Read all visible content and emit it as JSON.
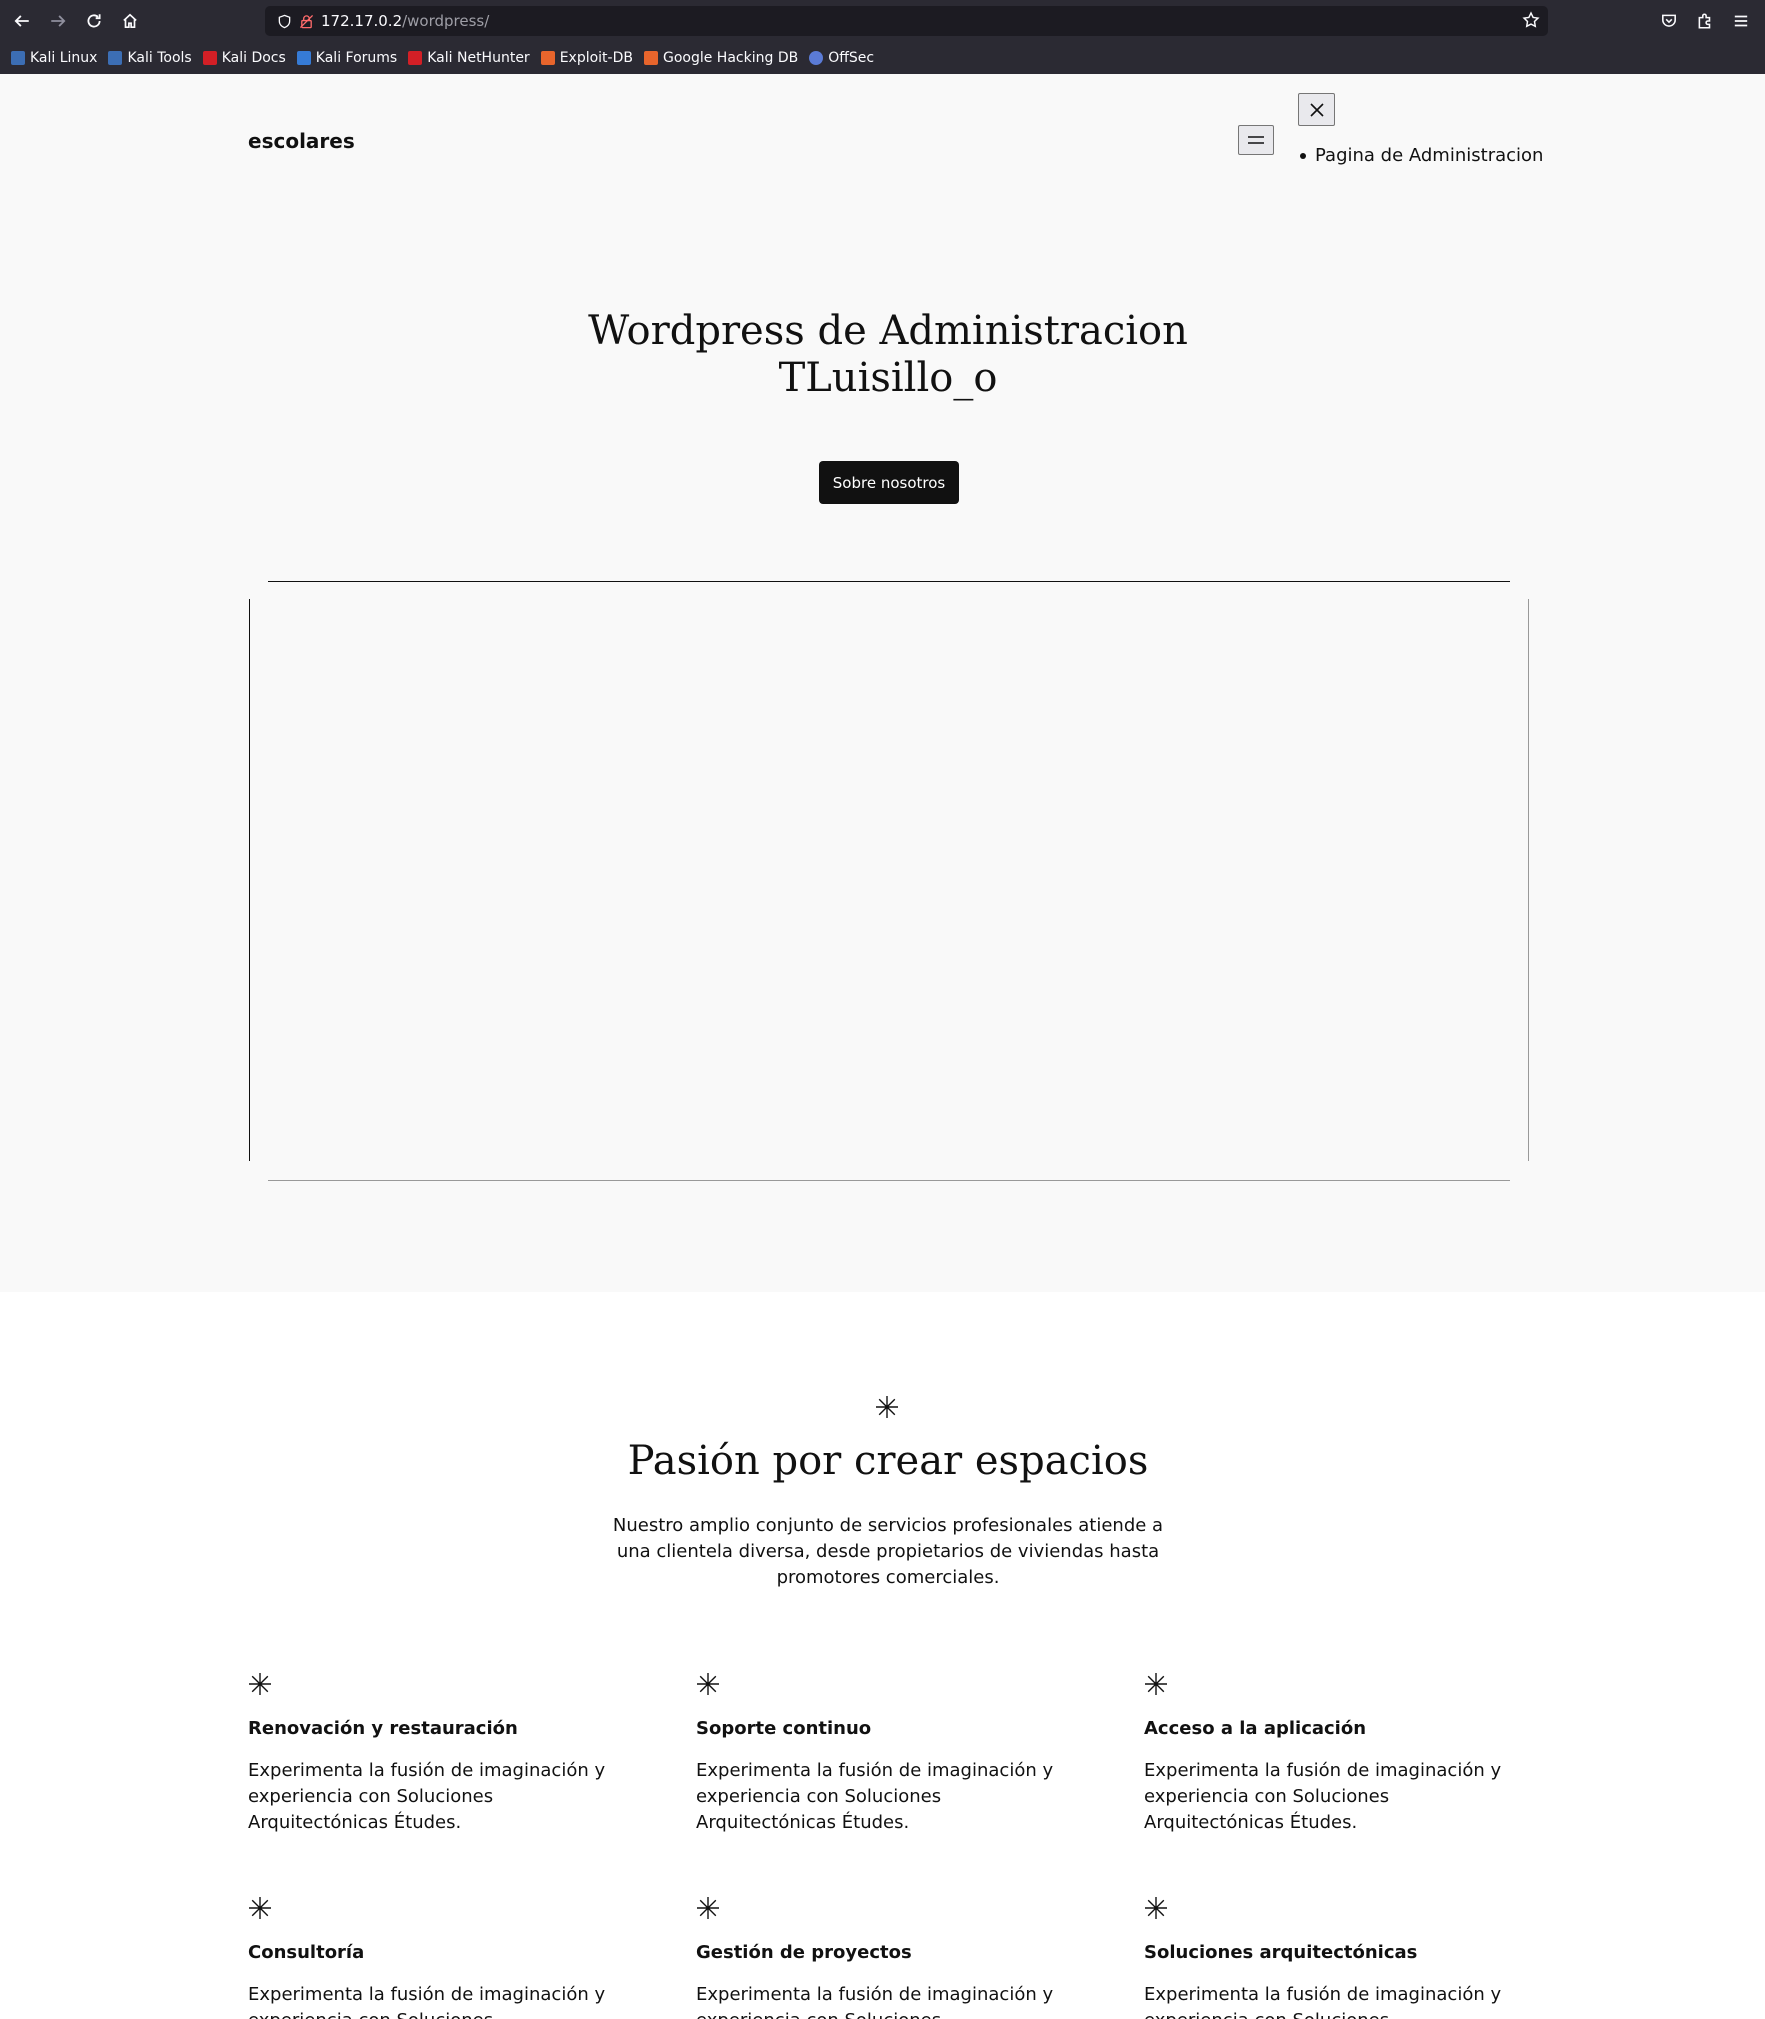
{
  "browser": {
    "url_host": "172.17.0.2",
    "url_path": "/wordpress/",
    "bookmarks": [
      {
        "label": "Kali Linux",
        "icon": "kali-dragon-icon",
        "color": "#3c6eb4"
      },
      {
        "label": "Kali Tools",
        "icon": "kali-tools-icon",
        "color": "#3c6eb4"
      },
      {
        "label": "Kali Docs",
        "icon": "kali-docs-icon",
        "color": "#d31f26"
      },
      {
        "label": "Kali Forums",
        "icon": "kali-forums-icon",
        "color": "#367bd6"
      },
      {
        "label": "Kali NetHunter",
        "icon": "kali-nethunter-icon",
        "color": "#d31f26"
      },
      {
        "label": "Exploit-DB",
        "icon": "exploit-db-icon",
        "color": "#e8652c"
      },
      {
        "label": "Google Hacking DB",
        "icon": "ghdb-icon",
        "color": "#e8652c"
      },
      {
        "label": "OffSec",
        "icon": "offsec-icon",
        "color": "#5b7bd6"
      }
    ]
  },
  "header": {
    "site_title": "escolares",
    "nav_item": "Pagina de Administracion"
  },
  "hero": {
    "title_line1": "Wordpress de Administracion",
    "title_line2": "TLuisillo_o",
    "cta_label": "Sobre nosotros"
  },
  "services": {
    "title": "Pasión por crear espacios",
    "description": "Nuestro amplio conjunto de servicios profesionales atiende a una clientela diversa, desde propietarios de viviendas hasta promotores comerciales.",
    "items": [
      {
        "title": "Renovación y restauración",
        "text": "Experimenta la fusión de imaginación y experiencia con Soluciones Arquitectónicas Études."
      },
      {
        "title": "Soporte continuo",
        "text": "Experimenta la fusión de imaginación y experiencia con Soluciones Arquitectónicas Études."
      },
      {
        "title": "Acceso a la aplicación",
        "text": "Experimenta la fusión de imaginación y experiencia con Soluciones Arquitectónicas Études."
      },
      {
        "title": "Consultoría",
        "text": "Experimenta la fusión de imaginación y experiencia con Soluciones Arquitectónicas Études."
      },
      {
        "title": "Gestión de proyectos",
        "text": "Experimenta la fusión de imaginación y experiencia con Soluciones Arquitectónicas Études."
      },
      {
        "title": "Soluciones arquitectónicas",
        "text": "Experimenta la fusión de imaginación y experiencia con Soluciones Arquitectónicas Études."
      }
    ]
  }
}
